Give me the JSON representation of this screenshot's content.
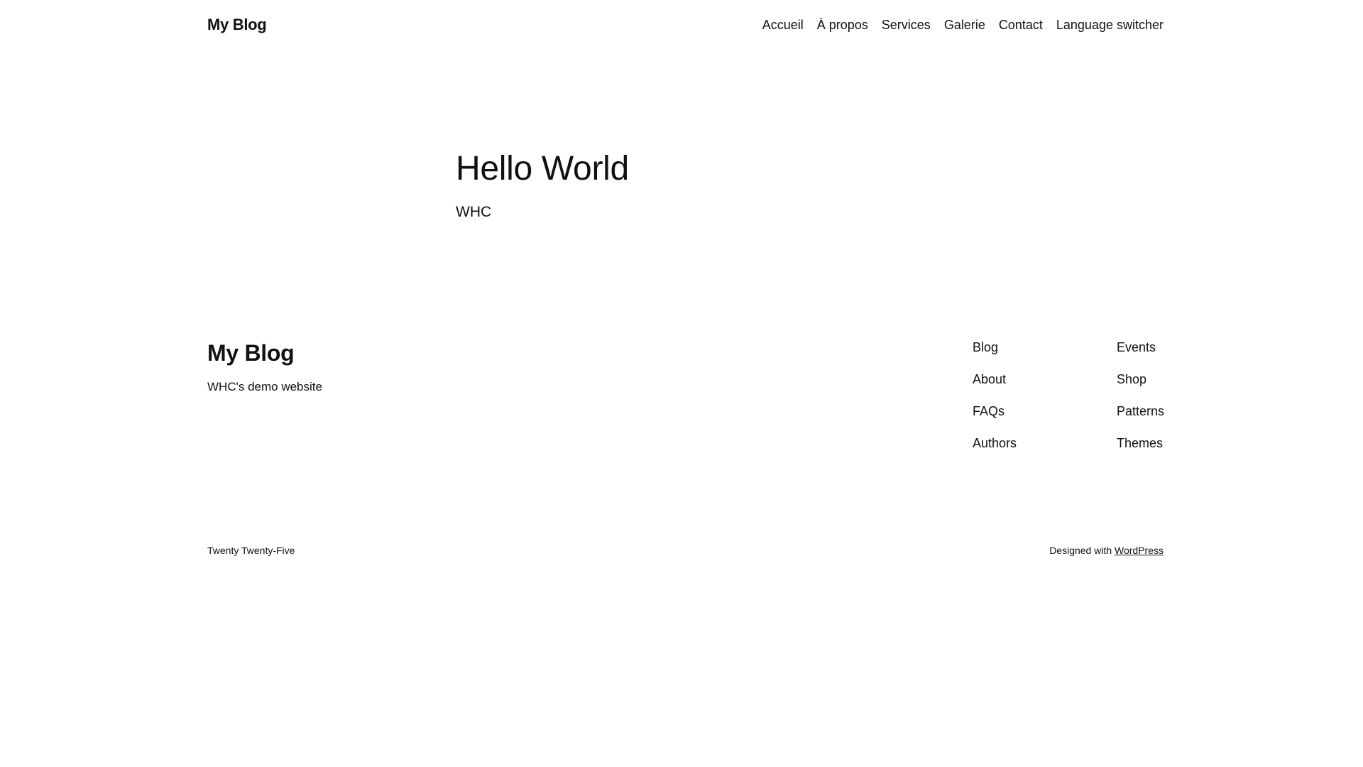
{
  "header": {
    "site_title": "My Blog",
    "nav": [
      {
        "label": "Accueil"
      },
      {
        "label": "À propos"
      },
      {
        "label": "Services"
      },
      {
        "label": "Galerie"
      },
      {
        "label": "Contact"
      },
      {
        "label": "Language switcher"
      }
    ]
  },
  "post": {
    "title": "Hello World",
    "content": "WHC"
  },
  "footer": {
    "site_title": "My Blog",
    "tagline": "WHC's demo website",
    "links_col1": [
      {
        "label": "Blog"
      },
      {
        "label": "About"
      },
      {
        "label": "FAQs"
      },
      {
        "label": "Authors"
      }
    ],
    "links_col2": [
      {
        "label": "Events"
      },
      {
        "label": "Shop"
      },
      {
        "label": "Patterns"
      },
      {
        "label": "Themes"
      }
    ],
    "theme_name": "Twenty Twenty-Five",
    "designed_with": "Designed with",
    "wordpress_link": "WordPress"
  }
}
